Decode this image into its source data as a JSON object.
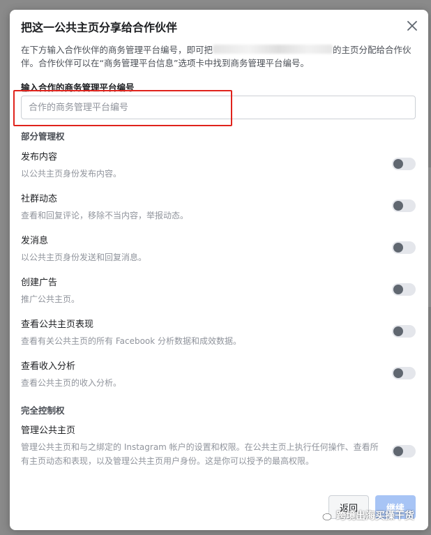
{
  "modal": {
    "title": "把这一公共主页分享给合作伙伴",
    "intro_part1": "在下方输入合作伙伴的商务管理平台编号，即可把",
    "intro_part2": "的主页分配给合作伙伴。合作伙伴可以在“商务管理平台信息”选项卡中找到商务管理平台编号。",
    "field_label": "输入合作的商务管理平台编号",
    "input_placeholder": "合作的商务管理平台编号",
    "input_value": ""
  },
  "partial_access": {
    "heading": "部分管理权",
    "items": [
      {
        "title": "发布内容",
        "desc": "以公共主页身份发布内容。",
        "enabled": false
      },
      {
        "title": "社群动态",
        "desc": "查看和回复评论，移除不当内容，举报动态。",
        "enabled": false
      },
      {
        "title": "发消息",
        "desc": "以公共主页身份发送和回复消息。",
        "enabled": false
      },
      {
        "title": "创建广告",
        "desc": "推广公共主页。",
        "enabled": false
      },
      {
        "title": "查看公共主页表现",
        "desc": "查看有关公共主页的所有 Facebook 分析数据和成效数据。",
        "enabled": false
      },
      {
        "title": "查看收入分析",
        "desc": "查看公共主页的收入分析。",
        "enabled": false
      }
    ]
  },
  "full_access": {
    "heading": "完全控制权",
    "items": [
      {
        "title": "管理公共主页",
        "desc": "管理公共主页和与之绑定的 Instagram 帐户的设置和权限。在公共主页上执行任何操作、查看所有主页动态和表现，以及管理公共主页用户身份。这是你可以授予的最高权限。",
        "enabled": false
      }
    ]
  },
  "footer": {
    "back_label": "返回",
    "next_label": "继续"
  },
  "watermark": {
    "text": "跨境出海买操干货"
  },
  "colors": {
    "highlight_box": "#e0231c",
    "next_button": "#a7c4f5",
    "toggle_track": "#e4e6eb",
    "toggle_knob": "#606770"
  }
}
